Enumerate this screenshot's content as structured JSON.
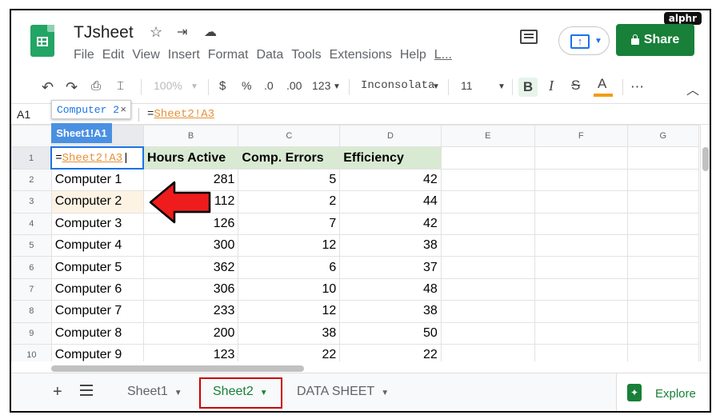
{
  "badge": "alphr",
  "doc": {
    "title": "TJsheet"
  },
  "menu": [
    "File",
    "Edit",
    "View",
    "Insert",
    "Format",
    "Data",
    "Tools",
    "Extensions",
    "Help",
    "L..."
  ],
  "share_label": "Share",
  "toolbar": {
    "zoom": "100%",
    "currency": "$",
    "percent": "%",
    "dec_less": ".0",
    "dec_more": ".00",
    "format_more": "123",
    "font": "Inconsolata",
    "size": "11",
    "bold": "B",
    "italic": "I",
    "strike": "S",
    "textcolor": "A",
    "more": "⋯",
    "collapse": "︿"
  },
  "formula_bar": {
    "cell_ref": "A1",
    "prefix": "=",
    "reference": "Sheet2!A3",
    "chip_text": "Computer 2",
    "chip_close": "×"
  },
  "name_box": "Sheet1!A1",
  "columns": [
    "",
    "B",
    "C",
    "D",
    "E",
    "F",
    "G"
  ],
  "header_row": {
    "a1_prefix": "=",
    "a1_ref": "Sheet2!A3",
    "b": "Hours Active",
    "c": "Comp. Errors",
    "d": "Efficiency"
  },
  "rows": [
    {
      "n": "2",
      "a": "Computer 1",
      "b": "281",
      "c": "5",
      "d": "42"
    },
    {
      "n": "3",
      "a": "Computer 2",
      "b": "112",
      "c": "2",
      "d": "44"
    },
    {
      "n": "4",
      "a": "Computer 3",
      "b": "126",
      "c": "7",
      "d": "42"
    },
    {
      "n": "5",
      "a": "Computer 4",
      "b": "300",
      "c": "12",
      "d": "38"
    },
    {
      "n": "6",
      "a": "Computer 5",
      "b": "362",
      "c": "6",
      "d": "37"
    },
    {
      "n": "7",
      "a": "Computer 6",
      "b": "306",
      "c": "10",
      "d": "48"
    },
    {
      "n": "8",
      "a": "Computer 7",
      "b": "233",
      "c": "12",
      "d": "38"
    },
    {
      "n": "9",
      "a": "Computer 8",
      "b": "200",
      "c": "38",
      "d": "50"
    },
    {
      "n": "10",
      "a": "Computer 9",
      "b": "123",
      "c": "22",
      "d": "22"
    }
  ],
  "sheets": [
    {
      "label": "Sheet1",
      "active": false
    },
    {
      "label": "Sheet2",
      "active": true
    },
    {
      "label": "DATA SHEET",
      "active": false
    }
  ],
  "explore_label": "Explore",
  "colors": {
    "accent_green": "#188038",
    "header_fill": "#d9ead3",
    "ref_orange": "#e69138",
    "highlight_red": "#cc0000"
  }
}
